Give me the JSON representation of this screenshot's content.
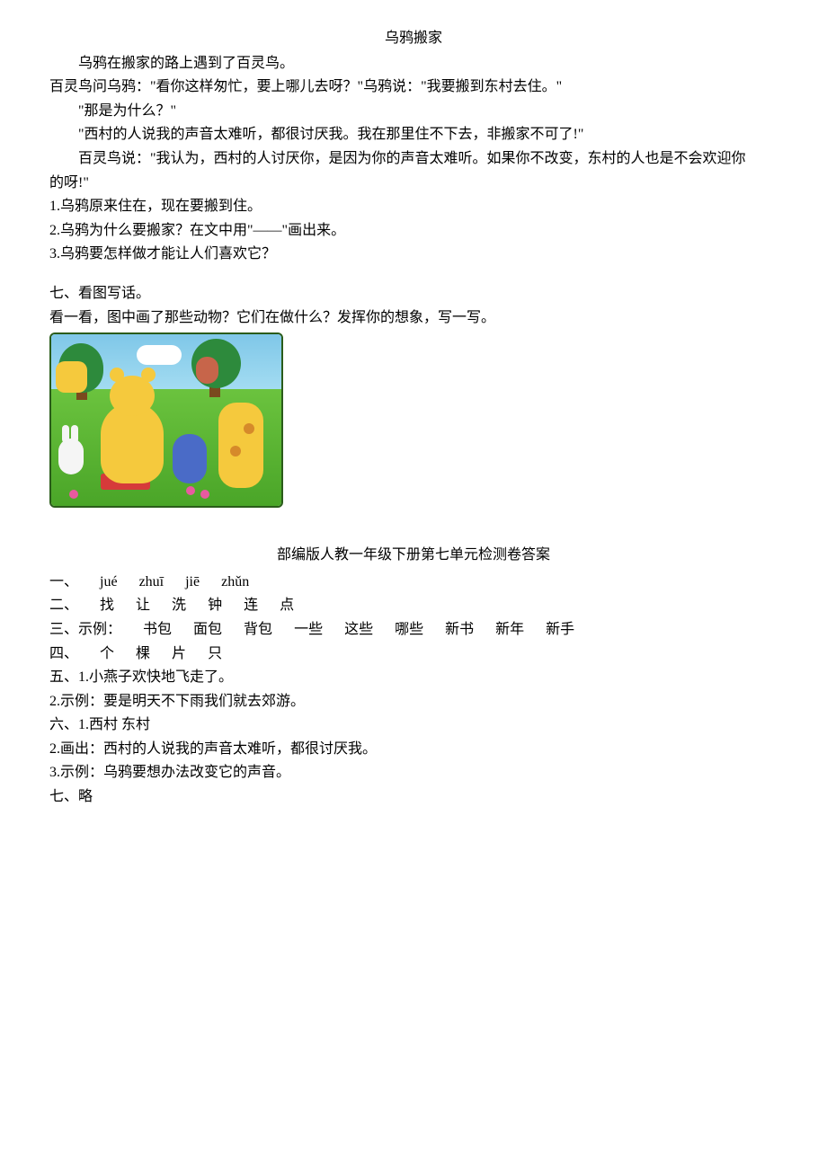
{
  "title": "乌鸦搬家",
  "story": {
    "p1": "乌鸦在搬家的路上遇到了百灵鸟。",
    "p2": "百灵鸟问乌鸦：\"看你这样匆忙，要上哪儿去呀？\"乌鸦说：\"我要搬到东村去住。\"",
    "p3": "\"那是为什么？\"",
    "p4": "\"西村的人说我的声音太难听，都很讨厌我。我在那里住不下去，非搬家不可了!\"",
    "p5": "百灵鸟说：\"我认为，西村的人讨厌你，是因为你的声音太难听。如果你不改变，东村的人也是不会欢迎你",
    "p5b": "的呀!\""
  },
  "questions": {
    "q1": "1.乌鸦原来住在，现在要搬到住。",
    "q2": "2.乌鸦为什么要搬家？在文中用\"——\"画出来。",
    "q3": "3.乌鸦要怎样做才能让人们喜欢它？"
  },
  "section7": {
    "heading": "七、看图写话。",
    "instruction": "看一看，图中画了那些动物？它们在做什么？发挥你的想象，写一写。"
  },
  "answers": {
    "title": "部编版人教一年级下册第七单元检测卷答案",
    "a1_label": "一、",
    "a1_items": [
      "jué",
      "zhuī",
      "jiē",
      "zhǔn"
    ],
    "a2_label": "二、",
    "a2_items": [
      "找",
      "让",
      "洗",
      "钟",
      "连",
      "点"
    ],
    "a3_label": "三、示例：",
    "a3_items": [
      "书包",
      "面包",
      "背包",
      "一些",
      "这些",
      "哪些",
      "新书",
      "新年",
      "新手"
    ],
    "a4_label": "四、",
    "a4_items": [
      "个",
      "棵",
      "片",
      "只"
    ],
    "a5": "五、1.小燕子欢快地飞走了。",
    "a5_2": "2.示例：要是明天不下雨我们就去郊游。",
    "a6": "六、1.西村    东村",
    "a6_2": "2.画出：西村的人说我的声音太难听，都很讨厌我。",
    "a6_3": "3.示例：乌鸦要想办法改变它的声音。",
    "a7": "七、略"
  }
}
